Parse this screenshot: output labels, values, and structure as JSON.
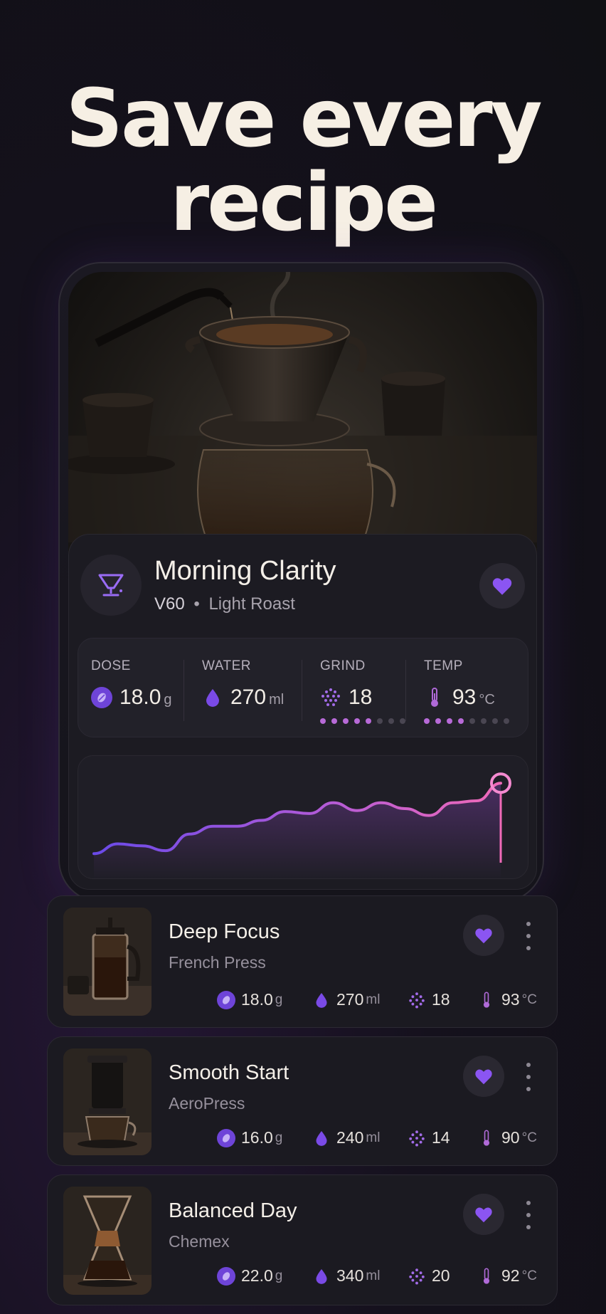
{
  "headline": {
    "line1": "Save every",
    "line2": "recipe"
  },
  "featured": {
    "title": "Morning Clarity",
    "method": "V60",
    "separator": "•",
    "roast": "Light Roast",
    "favorited": true,
    "stats": {
      "dose": {
        "label": "DOSE",
        "value": "18.0",
        "unit": "g"
      },
      "water": {
        "label": "WATER",
        "value": "270",
        "unit": "ml"
      },
      "grind": {
        "label": "GRIND",
        "value": "18",
        "level": 5,
        "max": 8
      },
      "temp": {
        "label": "TEMP",
        "value": "93",
        "unit": "°C",
        "level": 4,
        "max": 8
      }
    },
    "chart_data": {
      "type": "area",
      "values": [
        2,
        12,
        10,
        5,
        22,
        30,
        30,
        36,
        45,
        43,
        54,
        46,
        54,
        48,
        41,
        54,
        56,
        74
      ]
    }
  },
  "recipes": [
    {
      "title": "Deep Focus",
      "method": "French Press",
      "favorited": true,
      "dose": "18.0",
      "dose_unit": "g",
      "water": "270",
      "water_unit": "ml",
      "grind": "18",
      "temp": "93",
      "temp_unit": "°C"
    },
    {
      "title": "Smooth Start",
      "method": "AeroPress",
      "favorited": true,
      "dose": "16.0",
      "dose_unit": "g",
      "water": "240",
      "water_unit": "ml",
      "grind": "14",
      "temp": "90",
      "temp_unit": "°C"
    },
    {
      "title": "Balanced Day",
      "method": "Chemex",
      "favorited": true,
      "dose": "22.0",
      "dose_unit": "g",
      "water": "340",
      "water_unit": "ml",
      "grind": "20",
      "temp": "92",
      "temp_unit": "°C"
    }
  ],
  "colors": {
    "accent": "#8a5cf0",
    "accent_pink": "#e06ad0",
    "bg": "#131118"
  },
  "icons": {
    "dripper": "v60-dripper-icon",
    "heart": "heart-icon",
    "bean": "coffee-bean-icon",
    "water": "water-drop-icon",
    "grind": "grind-dots-icon",
    "temp": "thermometer-icon",
    "more": "more-vertical-icon"
  }
}
